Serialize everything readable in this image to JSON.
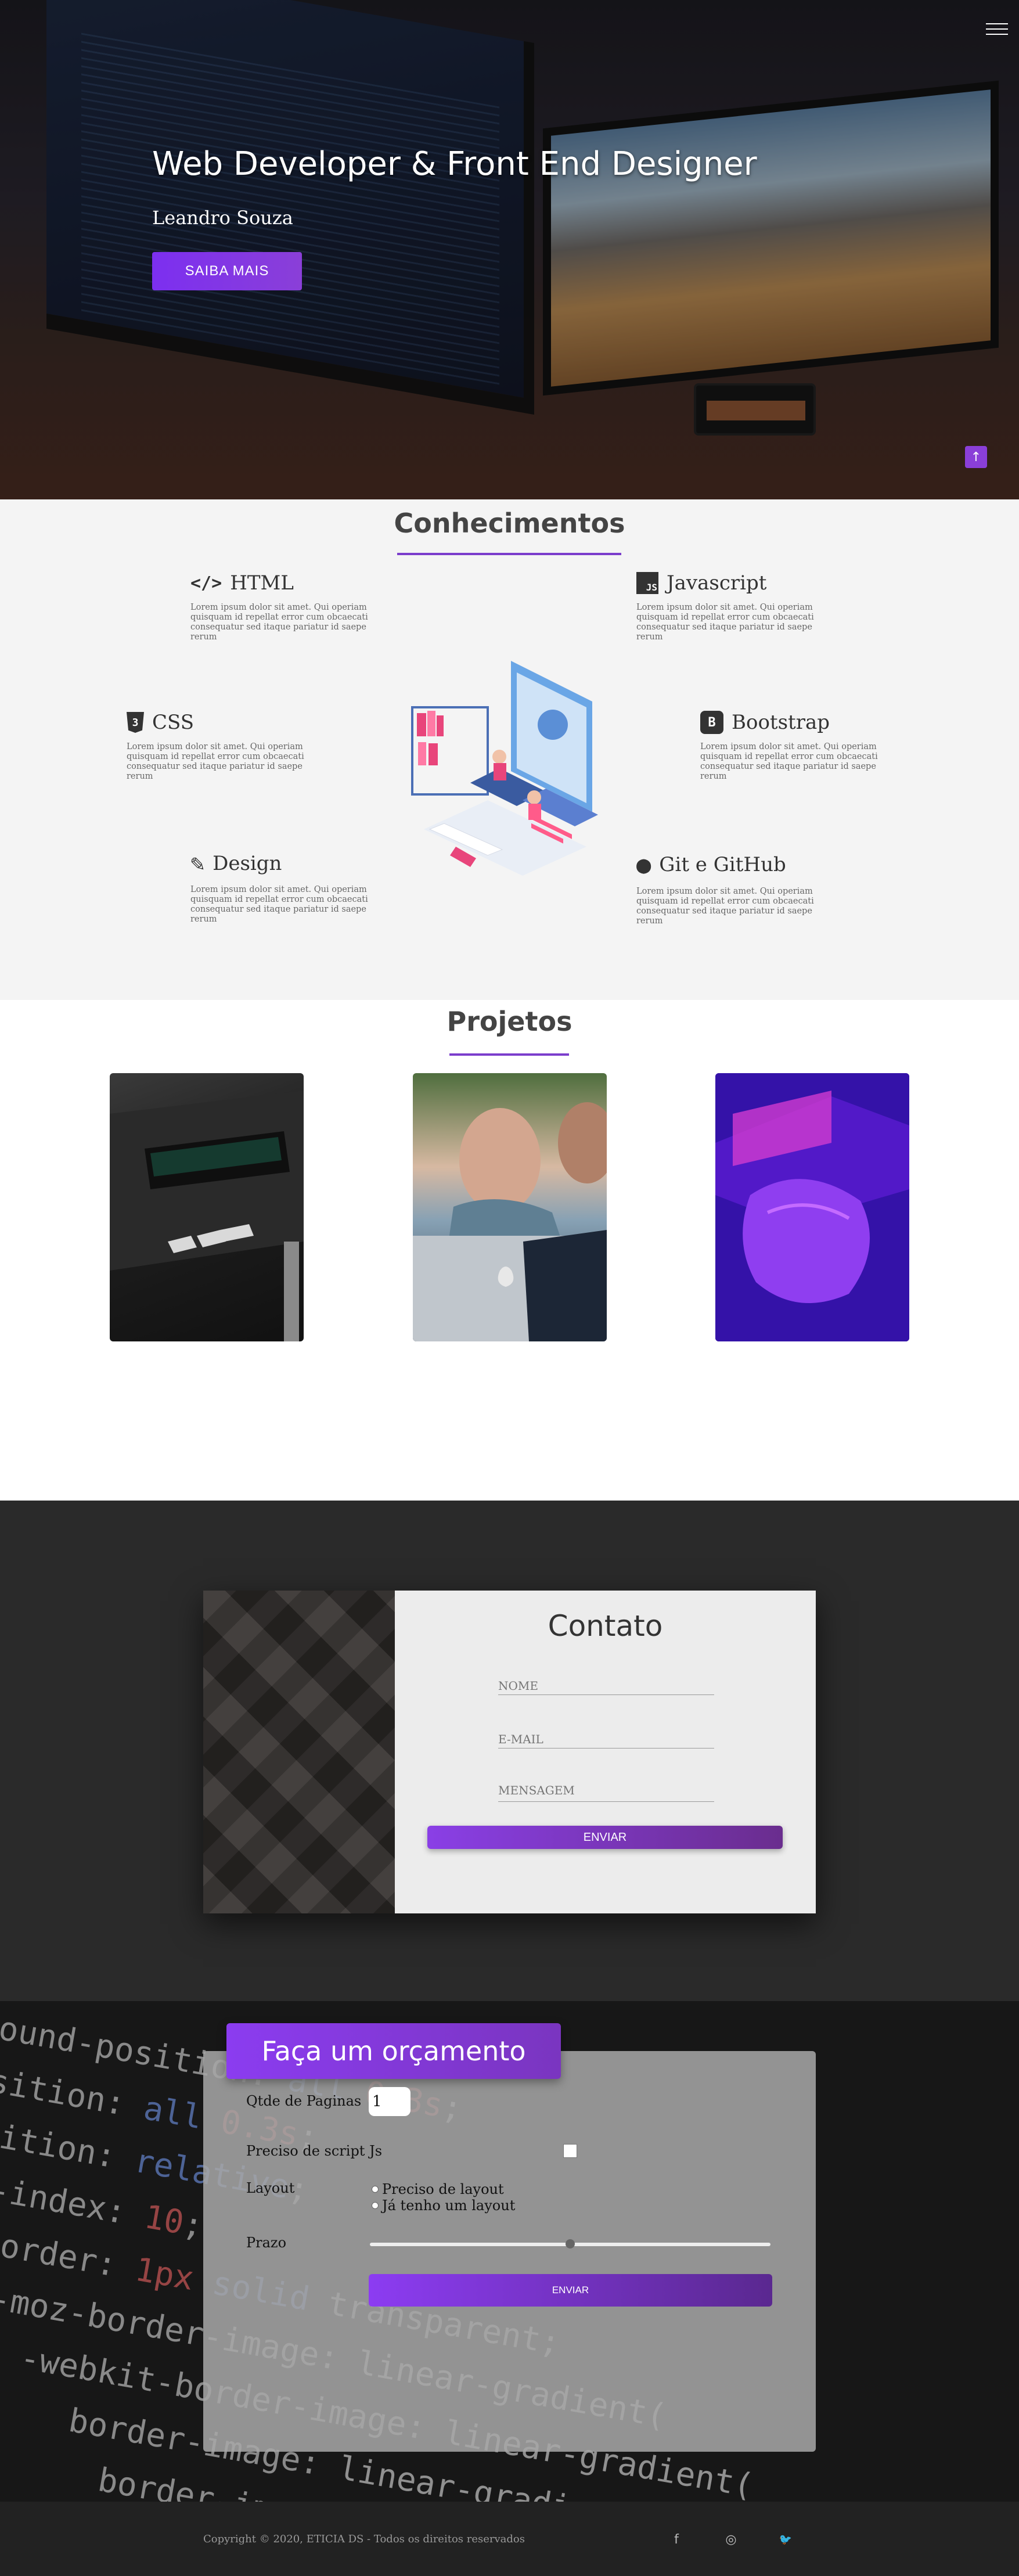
{
  "hero": {
    "title": "Web Developer & Front End Designer",
    "name": "Leandro Souza",
    "button": "SAIBA MAIS",
    "menu_icon": "hamburger-icon",
    "back_to_top_icon": "arrow-up-icon"
  },
  "conhecimentos": {
    "title": "Conhecimentos",
    "lorem": "Lorem ipsum dolor sit amet. Qui operiam quisquam id repellat error cum obcaecati consequatur sed itaque pariatur id saepe rerum",
    "skills": [
      {
        "name": "HTML",
        "icon": "code-icon",
        "icon_text": "</>"
      },
      {
        "name": "Javascript",
        "icon": "js-icon",
        "icon_text": "JS"
      },
      {
        "name": "CSS",
        "icon": "css3-icon",
        "icon_text": "3"
      },
      {
        "name": "Bootstrap",
        "icon": "bootstrap-icon",
        "icon_text": "B"
      },
      {
        "name": "Design",
        "icon": "pencil-icon",
        "icon_text": "✎"
      },
      {
        "name": "Git e GitHub",
        "icon": "github-icon",
        "icon_text": "●"
      }
    ]
  },
  "projetos": {
    "title": "Projetos"
  },
  "contato": {
    "title": "Contato",
    "nome_placeholder": "NOME",
    "email_placeholder": "E-MAIL",
    "mensagem_placeholder": "MENSAGEM",
    "button": "ENVIAR"
  },
  "orcamento": {
    "title": "Faça um orçamento",
    "qtd_label": "Qtde de Paginas",
    "qtd_value": "1",
    "script_label": "Preciso de script Js",
    "layout_label": "Layout",
    "layout_options": [
      "Preciso de layout",
      "Já tenho um layout"
    ],
    "prazo_label": "Prazo",
    "prazo_slider_value": 0.5,
    "button": "ENVIAR"
  },
  "footer": {
    "copyright": "Copyright © 2020, ETICIA DS - Todos os direitos reservados",
    "social": [
      {
        "name": "facebook-icon",
        "glyph": "f"
      },
      {
        "name": "instagram-icon",
        "glyph": "◎"
      },
      {
        "name": "twitter-icon",
        "glyph": "🐦"
      }
    ]
  },
  "colors": {
    "accent": "#7b3dcc",
    "button_gradient_start": "#8a3fe6",
    "button_gradient_end": "#6a2d8e"
  }
}
